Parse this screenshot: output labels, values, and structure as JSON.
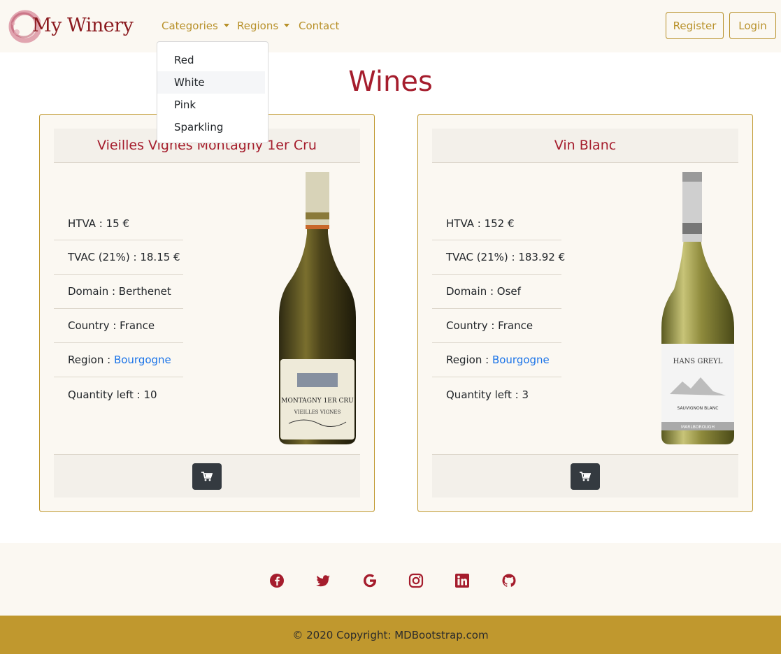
{
  "brand": {
    "name": "My Winery"
  },
  "nav": {
    "categories_label": "Categories",
    "regions_label": "Regions",
    "contact_label": "Contact",
    "register_label": "Register",
    "login_label": "Login"
  },
  "dropdown": {
    "items": [
      "Red",
      "White",
      "Pink",
      "Sparkling"
    ],
    "highlighted": "White"
  },
  "page": {
    "title": "Wines"
  },
  "wines": [
    {
      "name": "Vieilles Vignes Montagny 1er Cru",
      "htva": "HTVA : 15 €",
      "tvac": "TVAC (21%) : 18.15 €",
      "domain": "Domain : Berthenet",
      "country": "Country : France",
      "region_prefix": "Region : ",
      "region": "Bourgogne",
      "quantity": "Quantity left : 10",
      "label_line1": "MONTAGNY 1ER CRU",
      "label_line2": "VIEILLES VIGNES"
    },
    {
      "name": "Vin Blanc",
      "htva": "HTVA : 152 €",
      "tvac": "TVAC (21%) : 183.92 €",
      "domain": "Domain : Osef",
      "country": "Country : France",
      "region_prefix": "Region : ",
      "region": "Bourgogne",
      "quantity": "Quantity left : 3",
      "label_line1": "HANS GREYL",
      "label_line2": "SAUVIGNON BLANC",
      "label_line3": "MARLBOROUGH"
    }
  ],
  "footer": {
    "social": [
      "facebook-icon",
      "twitter-icon",
      "google-icon",
      "instagram-icon",
      "linkedin-icon",
      "github-icon"
    ],
    "copyright": "© 2020 Copyright: MDBootstrap.com"
  },
  "colors": {
    "accent_gold": "#c0982e",
    "wine_red": "#a51d2d",
    "link_blue": "#1a73e8",
    "dark_button": "#343a40"
  }
}
